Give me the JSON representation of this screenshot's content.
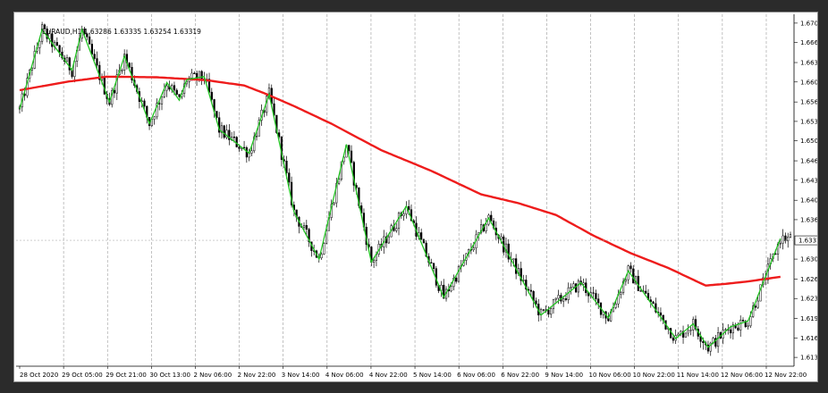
{
  "symbol_info": "EURAUD,H1  1.63286 1.63335 1.63254 1.63319",
  "chart_data": {
    "type": "candlestick",
    "symbol": "EURAUD",
    "timeframe": "H1",
    "ohlc_header": {
      "open": 1.63286,
      "high": 1.63335,
      "low": 1.63254,
      "close": 1.63319
    },
    "current_price_label": "1.63319",
    "current_price": 1.63319,
    "ylim": [
      1.6118,
      1.6716
    ],
    "price_ticks": [
      "1.67010",
      "1.66680",
      "1.66340",
      "1.66010",
      "1.65670",
      "1.65340",
      "1.65010",
      "1.64670",
      "1.64340",
      "1.64000",
      "1.63670",
      "1.63000",
      "1.62660",
      "1.62330",
      "1.61990",
      "1.61660",
      "1.61330"
    ],
    "time_ticks": [
      "28 Oct 2020",
      "29 Oct 05:00",
      "29 Oct 21:00",
      "30 Oct 13:00",
      "2 Nov 06:00",
      "2 Nov 22:00",
      "3 Nov 14:00",
      "4 Nov 06:00",
      "4 Nov 22:00",
      "5 Nov 14:00",
      "6 Nov 06:00",
      "6 Nov 22:00",
      "9 Nov 14:00",
      "10 Nov 06:00",
      "10 Nov 22:00",
      "11 Nov 14:00",
      "12 Nov 06:00",
      "12 Nov 22:00"
    ],
    "vertical_grid": "dashed",
    "zigzag_color": "#22c322",
    "ma_color": "#ee1c1c",
    "zigzag": [
      {
        "i": 0,
        "p": 1.6555
      },
      {
        "i": 9,
        "p": 1.669
      },
      {
        "i": 21,
        "p": 1.6621
      },
      {
        "i": 25,
        "p": 1.669
      },
      {
        "i": 36,
        "p": 1.6567
      },
      {
        "i": 42,
        "p": 1.6645
      },
      {
        "i": 52,
        "p": 1.653
      },
      {
        "i": 59,
        "p": 1.66
      },
      {
        "i": 64,
        "p": 1.657
      },
      {
        "i": 67,
        "p": 1.6605
      },
      {
        "i": 74,
        "p": 1.661
      },
      {
        "i": 80,
        "p": 1.652
      },
      {
        "i": 92,
        "p": 1.648
      },
      {
        "i": 100,
        "p": 1.658
      },
      {
        "i": 110,
        "p": 1.638
      },
      {
        "i": 120,
        "p": 1.63
      },
      {
        "i": 131,
        "p": 1.6495
      },
      {
        "i": 141,
        "p": 1.6295
      },
      {
        "i": 155,
        "p": 1.639
      },
      {
        "i": 170,
        "p": 1.6235
      },
      {
        "i": 188,
        "p": 1.637
      },
      {
        "i": 209,
        "p": 1.6205
      },
      {
        "i": 225,
        "p": 1.626
      },
      {
        "i": 236,
        "p": 1.62
      },
      {
        "i": 244,
        "p": 1.628
      },
      {
        "i": 263,
        "p": 1.6165
      },
      {
        "i": 270,
        "p": 1.619
      },
      {
        "i": 276,
        "p": 1.615
      },
      {
        "i": 285,
        "p": 1.6185
      },
      {
        "i": 292,
        "p": 1.6195
      },
      {
        "i": 305,
        "p": 1.6335
      }
    ],
    "moving_average": [
      {
        "i": 0,
        "p": 1.6587
      },
      {
        "i": 20,
        "p": 1.6602
      },
      {
        "i": 35,
        "p": 1.661
      },
      {
        "i": 55,
        "p": 1.6609
      },
      {
        "i": 75,
        "p": 1.6604
      },
      {
        "i": 90,
        "p": 1.6595
      },
      {
        "i": 98,
        "p": 1.6582
      },
      {
        "i": 110,
        "p": 1.656
      },
      {
        "i": 125,
        "p": 1.653
      },
      {
        "i": 145,
        "p": 1.6485
      },
      {
        "i": 165,
        "p": 1.645
      },
      {
        "i": 185,
        "p": 1.641
      },
      {
        "i": 200,
        "p": 1.6395
      },
      {
        "i": 215,
        "p": 1.6375
      },
      {
        "i": 230,
        "p": 1.634
      },
      {
        "i": 245,
        "p": 1.631
      },
      {
        "i": 260,
        "p": 1.6285
      },
      {
        "i": 275,
        "p": 1.6255
      },
      {
        "i": 283,
        "p": 1.6258
      },
      {
        "i": 292,
        "p": 1.6262
      },
      {
        "i": 305,
        "p": 1.627
      }
    ]
  }
}
